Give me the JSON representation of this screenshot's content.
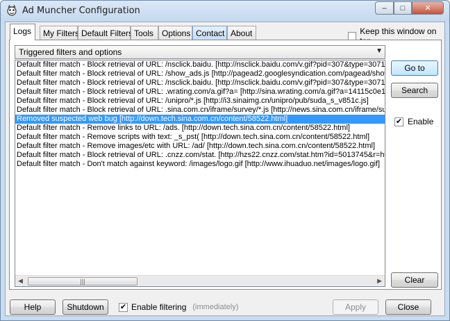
{
  "window": {
    "title": "Ad Muncher Configuration",
    "buttons": {
      "minimize": "–",
      "maximize": "□",
      "close": "✕"
    }
  },
  "tabs": [
    "Logs",
    "My Filters",
    "Default Filters",
    "Tools",
    "Options",
    "Contact",
    "About"
  ],
  "keep_on_top": {
    "label": "Keep this window on top",
    "checked": false
  },
  "log_type": {
    "selected": "Triggered filters and options"
  },
  "log_rows": [
    "Default filter match - Block retrieval of URL: /nsclick.baidu. [http://nsclick.baidu.com/v.gif?pid=307&type=3071&",
    "Default filter match - Block retrieval of URL: /show_ads.js [http://pagead2.googlesyndication.com/pagead/show_",
    "Default filter match - Block retrieval of URL: /nsclick.baidu. [http://nsclick.baidu.com/v.gif?pid=307&type=3071&",
    "Default filter match - Block retrieval of URL: .wrating.com/a.gif?a= [http://sina.wrating.com/a.gif?a=14115c0e1b",
    "Default filter match - Block retrieval of URL: /unipro/*.js [http://i3.sinaimg.cn/unipro/pub/suda_s_v851c.js]",
    "Default filter match - Block retrieval of URL: .sina.com.cn/iframe/survey/*.js [http://news.sina.com.cn/iframe/su",
    "Removed suspected web bug [http://down.tech.sina.com.cn/content/58522.html]",
    "Default filter match - Remove links to URL: /ads. [http://down.tech.sina.com.cn/content/58522.html]",
    "Default filter match - Remove scripts with text: _s_pst( [http://down.tech.sina.com.cn/content/58522.html]",
    "Default filter match - Remove images/etc with URL: /ad/ [http://down.tech.sina.com.cn/content/58522.html]",
    "Default filter match - Block retrieval of URL: .cnzz.com/stat. [http://hzs22.cnzz.com/stat.htm?id=5013745&r=http",
    "Default filter match - Don't match against keyword: /images/logo.gif [http://www.ihuaduo.net/images/logo.gif]"
  ],
  "selected_row_index": 6,
  "side": {
    "goto": "Go to",
    "search": "Search",
    "enable_label": "Enable",
    "enable_checked": true,
    "clear": "Clear"
  },
  "bottom": {
    "help": "Help",
    "shutdown": "Shutdown",
    "enable_filtering_label": "Enable filtering",
    "enable_filtering_checked": true,
    "enable_filtering_hint": "(immediately)",
    "apply": "Apply",
    "close": "Close"
  },
  "colors": {
    "selection": "#3399ff",
    "titlebar": "#c4d8ee"
  }
}
